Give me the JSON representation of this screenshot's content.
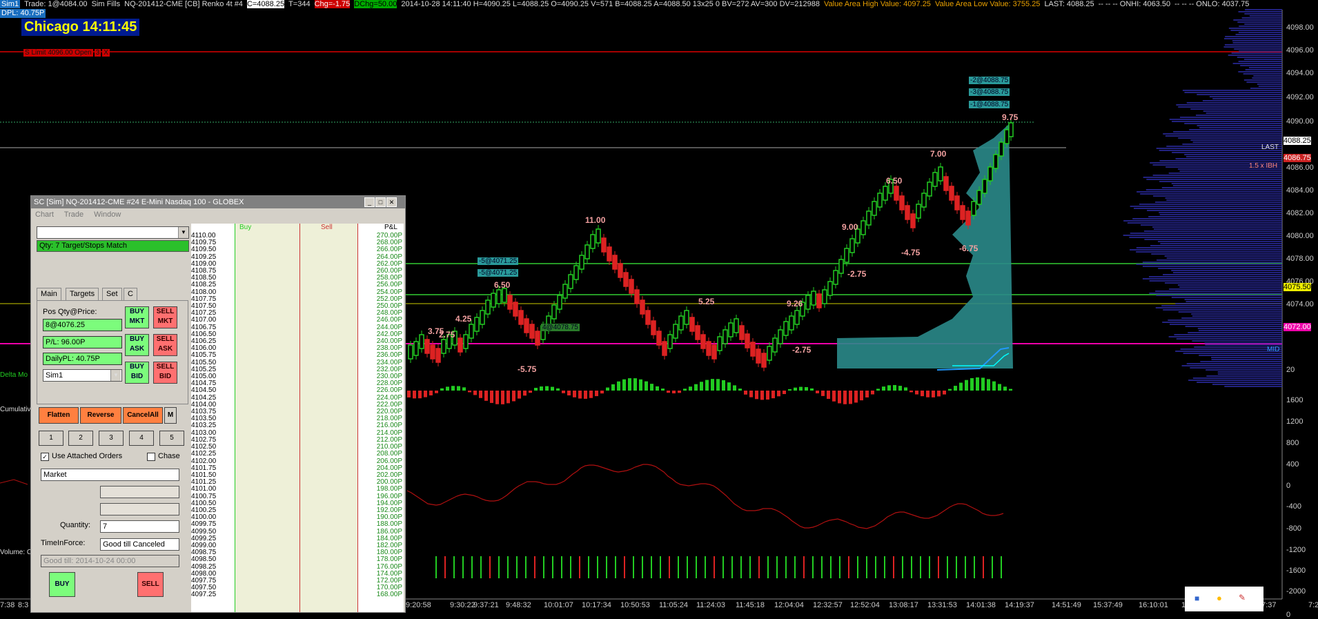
{
  "topbar": {
    "sim": "Sim1",
    "trade": "Trade: 1@4084.00",
    "simfills": "Sim Fills",
    "symbol": "NQ-201412-CME [CB]  Renko 4t  #4",
    "close": "C=4088.25",
    "ticks": "T=344",
    "chg": "Chg=-1.75",
    "dchg": "DChg=50.00",
    "stats": "2014-10-28 14:11:40 H=4090.25 L=4088.25 O=4090.25 V=571 B=4088.25 A=4088.50 13x25 0 BV=272 AV=300 DV=212988",
    "vah": "Value Area High Value: 4097.25",
    "val": "Value Area Low Value: 3755.25",
    "last": "LAST: 4088.25",
    "onhi": "-- -- -- ONHI: 4063.50",
    "onlo": "-- -- -- ONLO: 4037.75",
    "dpl": "DPL: 40.75P"
  },
  "clock": "Chicago 14:11:45",
  "order_tag": [
    "S Limit 4096.00 Open",
    "3",
    "X"
  ],
  "annotations": [
    {
      "text": "11.00"
    },
    {
      "text": "6.50"
    },
    {
      "text": "4.25"
    },
    {
      "text": "3.75"
    },
    {
      "text": "2.75"
    },
    {
      "text": "5.25"
    },
    {
      "text": "9.26"
    },
    {
      "text": "-2.75"
    },
    {
      "text": "9.00"
    },
    {
      "text": "-2.75"
    },
    {
      "text": "6.50"
    },
    {
      "text": "-4.75"
    },
    {
      "text": "7.00"
    },
    {
      "text": "-6.75"
    },
    {
      "text": "9.75"
    },
    {
      "text": "-5.75"
    }
  ],
  "side_labels": {
    "delta": "Delta Mo",
    "cumulative": "Cumulativ",
    "volume": "Volume: C",
    "last": "LAST",
    "ibh": "1.5 x IBH",
    "mid": "MID"
  },
  "teal_tags": [
    "-2@4088.75",
    "-3@4088.75",
    "-1@4088.75",
    "-5@4071.25",
    "-5@4071.25",
    "4@4078.75"
  ],
  "price_axis": [
    "4098.00",
    "4096.00",
    "4094.00",
    "4092.00",
    "4090.00",
    "4088.25",
    "4086.75",
    "4086.00",
    "4084.00",
    "4082.00",
    "4080.00",
    "4078.00",
    "4076.00",
    "4075.50",
    "4074.00",
    "4072.00",
    "20",
    "1600",
    "1200",
    "800",
    "400",
    "0",
    "-400",
    "-800",
    "-1200",
    "-1600",
    "-2000",
    "0"
  ],
  "time_axis": [
    "7:38",
    "8:3",
    "9:20:58",
    "9:30:22",
    "9:37:21",
    "9:48:32",
    "10:01:07",
    "10:17:34",
    "10:50:53",
    "11:05:24",
    "11:24:03",
    "11:45:18",
    "12:04:04",
    "12:32:57",
    "12:52:04",
    "13:08:17",
    "13:31:53",
    "14:01:38",
    "14:19:37",
    "14:51:49",
    "15:37:49",
    "16:10:01",
    "16:42",
    "17:37",
    "7:2"
  ],
  "window": {
    "title": "SC [Sim] NQ-201412-CME  #24  E-Mini Nasdaq 100 - GLOBEX",
    "menu": [
      "Chart",
      "Trade",
      "Window"
    ],
    "qty_status": "Qty: 7 Target/Stops Match",
    "tabs": [
      "Main",
      "Targets",
      "Set",
      "C"
    ],
    "pos_label": "Pos Qty@Price:",
    "pos_value": "8@4076.25",
    "pl": "P/L: 96.00P",
    "daily_pl": "DailyPL: 40.75P",
    "account": "Sim1",
    "buy_mkt": "BUY MKT",
    "sell_mkt": "SELL MKT",
    "buy_ask": "BUY ASK",
    "sell_ask": "SELL ASK",
    "buy_bid": "BUY BID",
    "sell_bid": "SELL BID",
    "flatten": "Flatten",
    "reverse": "Reverse",
    "cancel_all": "CancelAll",
    "m": "M",
    "qty_buttons": [
      "1",
      "2",
      "3",
      "4",
      "5"
    ],
    "use_attached": "Use Attached Orders",
    "chase": "Chase",
    "order_type": "Market",
    "quantity_label": "Quantity:",
    "quantity": "7",
    "tif_label": "TimeInForce:",
    "tif": "Good till Canceled",
    "good_till": "Good till: 2014-10-24 00:00",
    "buy": "BUY",
    "sell": "SELL"
  },
  "ladder": {
    "headers": {
      "buy": "Buy",
      "sell": "Sell",
      "pl": "P&L"
    },
    "prices": [
      "4110.00",
      "4109.75",
      "4109.50",
      "4109.25",
      "4109.00",
      "4108.75",
      "4108.50",
      "4108.25",
      "4108.00",
      "4107.75",
      "4107.50",
      "4107.25",
      "4107.00",
      "4106.75",
      "4106.50",
      "4106.25",
      "4106.00",
      "4105.75",
      "4105.50",
      "4105.25",
      "4105.00",
      "4104.75",
      "4104.50",
      "4104.25",
      "4104.00",
      "4103.75",
      "4103.50",
      "4103.25",
      "4103.00",
      "4102.75",
      "4102.50",
      "4102.25",
      "4102.00",
      "4101.75",
      "4101.50",
      "4101.25",
      "4101.00",
      "4100.75",
      "4100.50",
      "4100.25",
      "4100.00",
      "4099.75",
      "4099.50",
      "4099.25",
      "4099.00",
      "4098.75",
      "4098.50",
      "4098.25",
      "4098.00",
      "4097.75",
      "4097.50",
      "4097.25"
    ],
    "pl": [
      "270.00P",
      "268.00P",
      "266.00P",
      "264.00P",
      "262.00P",
      "260.00P",
      "258.00P",
      "256.00P",
      "254.00P",
      "252.00P",
      "250.00P",
      "248.00P",
      "246.00P",
      "244.00P",
      "242.00P",
      "240.00P",
      "238.00P",
      "236.00P",
      "234.00P",
      "232.00P",
      "230.00P",
      "228.00P",
      "226.00P",
      "224.00P",
      "222.00P",
      "220.00P",
      "218.00P",
      "216.00P",
      "214.00P",
      "212.00P",
      "210.00P",
      "208.00P",
      "206.00P",
      "204.00P",
      "202.00P",
      "200.00P",
      "198.00P",
      "196.00P",
      "194.00P",
      "192.00P",
      "190.00P",
      "188.00P",
      "186.00P",
      "184.00P",
      "182.00P",
      "180.00P",
      "178.00P",
      "176.00P",
      "174.00P",
      "172.00P",
      "170.00P",
      "168.00P"
    ]
  },
  "colors": {
    "up": "#22cc22",
    "down": "#dd2222",
    "teal": "#2a9a9a",
    "profile": "#2a2a8a",
    "magenta": "#ff00aa"
  }
}
